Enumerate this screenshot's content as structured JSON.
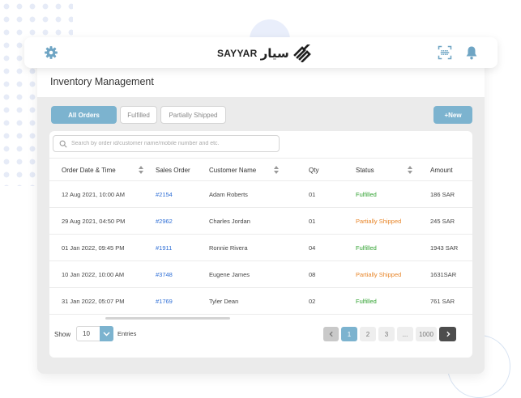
{
  "header": {
    "brand_en": "SAYYAR",
    "brand_ar": "سيار"
  },
  "page": {
    "title": "Inventory Management"
  },
  "filters": {
    "tabs": [
      {
        "label": "All Orders",
        "active": true
      },
      {
        "label": "Fulfilled",
        "active": false
      },
      {
        "label": "Partially Shipped",
        "active": false
      }
    ],
    "new_button": "+New"
  },
  "search": {
    "placeholder": "Search by order id/customer name/mobile number and etc.",
    "value": ""
  },
  "table": {
    "columns": [
      "Order Date & Time",
      "Sales Order",
      "Customer Name",
      "Qty",
      "Status",
      "Amount"
    ],
    "rows": [
      {
        "date": "12 Aug 2021, 10:00 AM",
        "order": "#2154",
        "customer": "Adam Roberts",
        "qty": "01",
        "status": "Fulfilled",
        "amount": "186 SAR"
      },
      {
        "date": "29 Aug 2021, 04:50 PM",
        "order": "#2962",
        "customer": "Charles Jordan",
        "qty": "01",
        "status": "Partially Shipped",
        "amount": "245 SAR"
      },
      {
        "date": "01 Jan 2022, 09:45 PM",
        "order": "#1911",
        "customer": "Ronnie Rivera",
        "qty": "04",
        "status": "Fulfilled",
        "amount": "1943 SAR"
      },
      {
        "date": "10 Jan 2022, 10:00 AM",
        "order": "#3748",
        "customer": "Eugene James",
        "qty": "08",
        "status": "Partially Shipped",
        "amount": "1631SAR"
      },
      {
        "date": "31 Jan 2022, 05:07 PM",
        "order": "#1769",
        "customer": "Tyler Dean",
        "qty": "02",
        "status": "Fulfilled",
        "amount": "761 SAR"
      }
    ]
  },
  "footer": {
    "show_label": "Show",
    "show_value": "10",
    "entries_label": "Entries",
    "pages": [
      "1",
      "2",
      "3",
      "...",
      "1000"
    ],
    "current_page": "1"
  },
  "colors": {
    "accent": "#7cb3cf",
    "link": "#2f6fd6",
    "fulfilled": "#33a333",
    "partial": "#e8862a"
  },
  "icons": {
    "settings": "gear-icon",
    "scan": "scan-icon",
    "notifications": "bell-icon",
    "search": "search-icon"
  }
}
